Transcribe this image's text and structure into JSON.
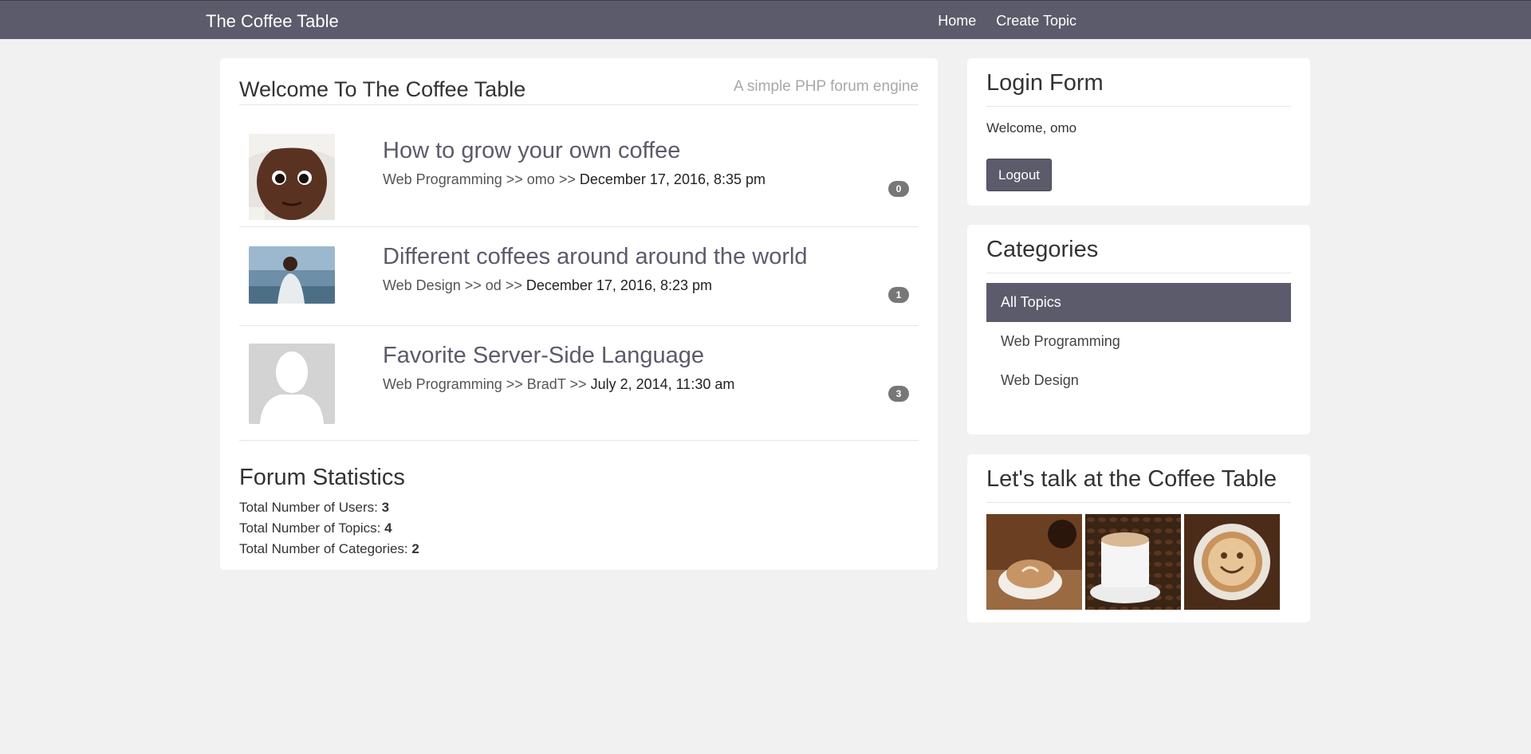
{
  "nav": {
    "brand": "The Coffee Table",
    "links": [
      "Home",
      "Create Topic"
    ]
  },
  "main": {
    "title": "Welcome To The Coffee Table",
    "subtitle": "A simple PHP forum engine",
    "topics": [
      {
        "title": "How to grow your own coffee",
        "category": "Web Programming",
        "user": "omo",
        "date": "December 17, 2016, 8:35 pm",
        "replies": "0"
      },
      {
        "title": "Different coffees around around the world",
        "category": "Web Design",
        "user": "od",
        "date": "December 17, 2016, 8:23 pm",
        "replies": "1"
      },
      {
        "title": "Favorite Server-Side Language",
        "category": "Web Programming",
        "user": "BradT",
        "date": "July 2, 2014, 11:30 am",
        "replies": "3"
      }
    ],
    "separator": ">>",
    "stats": {
      "title": "Forum Statistics",
      "users_label": "Total Number of Users:",
      "users": "3",
      "topics_label": "Total Number of Topics:",
      "topics": "4",
      "categories_label": "Total Number of Categories:",
      "categories": "2"
    }
  },
  "login": {
    "title": "Login Form",
    "welcome": "Welcome, omo",
    "logout_label": "Logout"
  },
  "categories": {
    "title": "Categories",
    "items": [
      "All Topics",
      "Web Programming",
      "Web Design"
    ]
  },
  "gallery": {
    "title": "Let's talk at the Coffee Table"
  },
  "colors": {
    "navbar": "#5b5b6b",
    "badge": "#777777",
    "background": "#f1f1f1"
  }
}
